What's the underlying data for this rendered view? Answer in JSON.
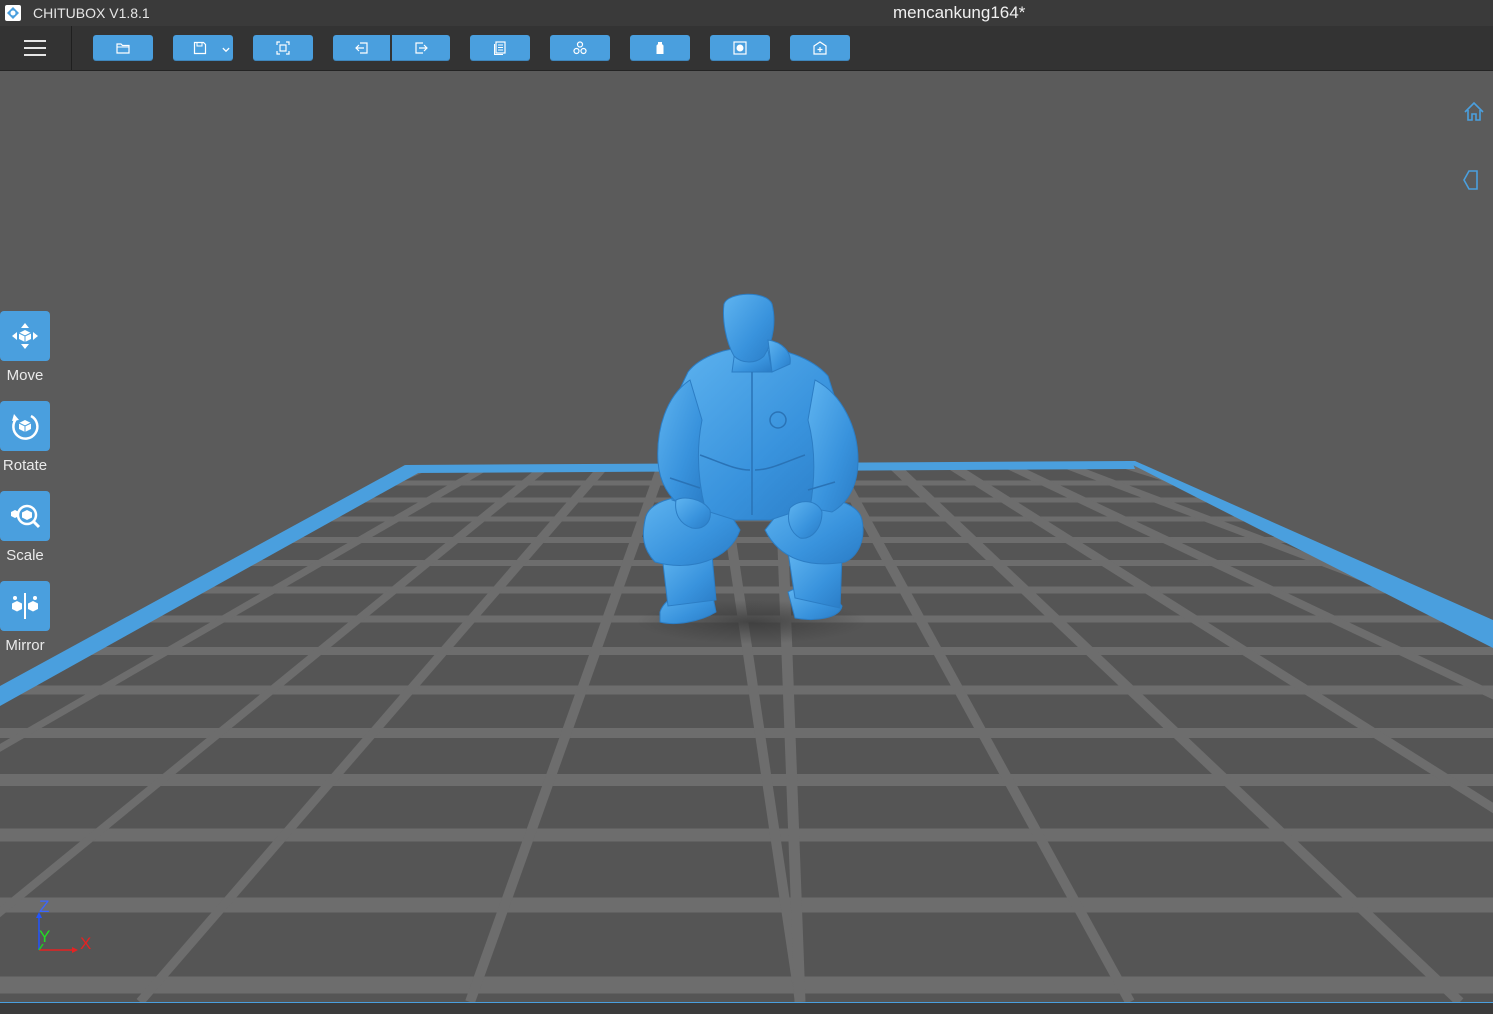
{
  "titlebar": {
    "app_title": "CHITUBOX V1.8.1",
    "doc_title": "mencankung164*"
  },
  "toolbar": {
    "buttons": [
      {
        "name": "open-file",
        "icon": "folder-open-icon"
      },
      {
        "name": "save",
        "icon": "save-icon"
      },
      {
        "name": "screenshot",
        "icon": "capture-icon"
      },
      {
        "name": "undo",
        "icon": "undo-icon"
      },
      {
        "name": "redo",
        "icon": "redo-icon"
      },
      {
        "name": "copy",
        "icon": "copy-icon"
      },
      {
        "name": "arrange",
        "icon": "arrange-icon"
      },
      {
        "name": "hollow",
        "icon": "hollow-icon"
      },
      {
        "name": "dig-hole",
        "icon": "dig-hole-icon"
      },
      {
        "name": "add-model",
        "icon": "add-model-icon"
      }
    ]
  },
  "tools": {
    "move": "Move",
    "rotate": "Rotate",
    "scale": "Scale",
    "mirror": "Mirror"
  },
  "axis": {
    "z": "Z",
    "y": "Y",
    "x": "X"
  },
  "colors": {
    "accent": "#4a9fde",
    "model": "#3d9be3",
    "background": "#5b5b5b",
    "toolbar": "#333333",
    "plate_grid": "#6e6e6e",
    "plate_border": "#4a9fde"
  }
}
